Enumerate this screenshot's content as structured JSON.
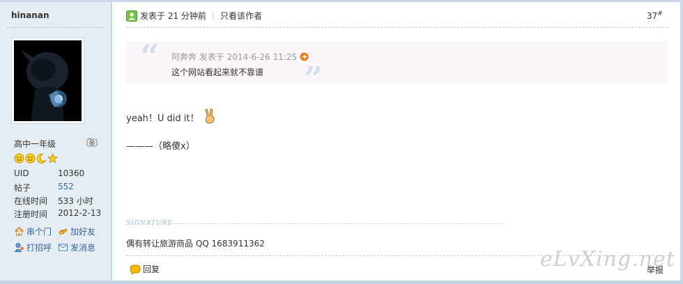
{
  "user": {
    "name": "hinanan",
    "rank": "高中一年级",
    "stats": [
      {
        "label": "UID",
        "value": "10360"
      },
      {
        "label": "帖子",
        "value": "552"
      },
      {
        "label": "在线时间",
        "value": "533 小时"
      },
      {
        "label": "注册时间",
        "value": "2012-2-13"
      }
    ],
    "actions": {
      "friend_circle": "串个门",
      "add_friend": "加好友",
      "greet": "打招呼",
      "message": "发消息"
    }
  },
  "post": {
    "posted": "发表于 21 分钟前",
    "only_author": "只看该作者",
    "floor_number": "37",
    "floor_mark": "#",
    "quote": {
      "author": "阿奔奔",
      "posted": "发表于 2014-6-26 11:25",
      "text": "这个网站看起来就不靠谱"
    },
    "message": {
      "line1": "yeah！U did it！",
      "line2": "———（略傻x）"
    },
    "signature_label": "SIGNATURE",
    "signature": "偶有转让旅游商品 QQ 1683911362",
    "reply": "回复",
    "report": "举报"
  },
  "watermark": "eLvXing.net",
  "colors": {
    "sidebar_bg": "#e5edf2",
    "link": "#336699",
    "quote_bg": "#faf6fa",
    "border": "#c2d5e3"
  },
  "icons": [
    "online-status-icon",
    "quote-jump-icon",
    "victory-hand-icon",
    "reply-icon",
    "home-icon",
    "add-friend-icon",
    "greet-icon",
    "envelope-icon",
    "rank-badge-icon",
    "smiley-icon",
    "moon-icon",
    "star-icon"
  ]
}
